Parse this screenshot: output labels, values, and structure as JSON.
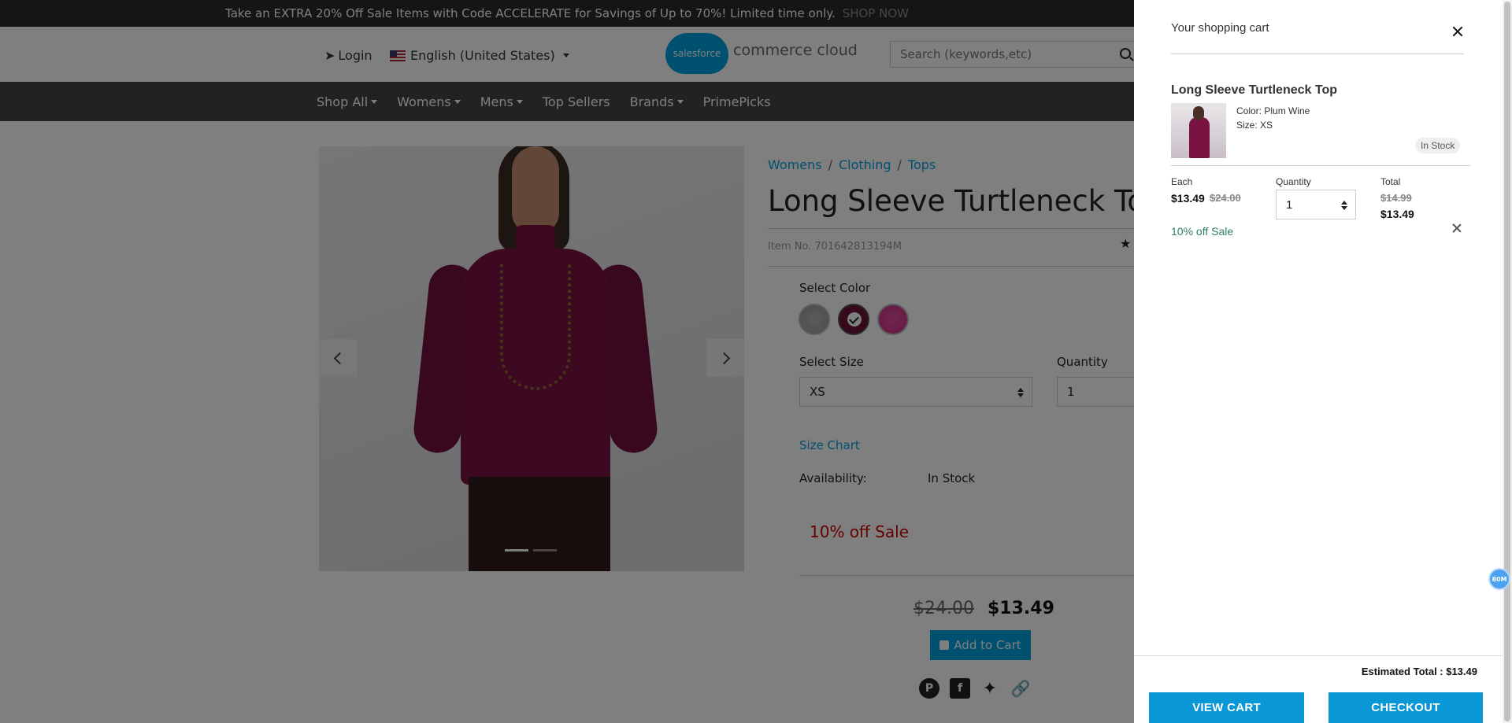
{
  "promo": {
    "text": "Take an EXTRA 20% Off Sale Items with Code ACCELERATE for Savings of Up to 70%! Limited time only.",
    "link": "SHOP NOW"
  },
  "header": {
    "login": "Login",
    "language": "English (United States)",
    "logo_badge": "salesforce",
    "logo_text": "commerce cloud",
    "search_placeholder": "Search (keywords,etc)"
  },
  "nav": [
    "Shop All",
    "Womens",
    "Mens",
    "Top Sellers",
    "Brands",
    "PrimePicks"
  ],
  "product": {
    "breadcrumb": [
      "Womens",
      "Clothing",
      "Tops"
    ],
    "title": "Long Sleeve Turtleneck Top",
    "item_no": "Item No. 701642813194M",
    "select_color_label": "Select Color",
    "colors": [
      "gray",
      "plum-wine",
      "pink"
    ],
    "selected_color": "plum-wine",
    "select_size_label": "Select Size",
    "size_value": "XS",
    "quantity_label": "Quantity",
    "quantity_value": "1",
    "size_chart": "Size Chart",
    "availability_label": "Availability:",
    "availability_value": "In Stock",
    "promo": "10% off Sale",
    "price_old": "$24.00",
    "price_new": "$13.49",
    "add_to_cart": "Add to Cart"
  },
  "cart": {
    "title": "Your shopping cart",
    "item": {
      "name": "Long Sleeve Turtleneck Top",
      "color": "Color: Plum Wine",
      "size": "Size: XS",
      "stock": "In Stock",
      "each_label": "Each",
      "each_price": "$13.49",
      "each_old": "$24.00",
      "quantity_label": "Quantity",
      "quantity": "1",
      "total_label": "Total",
      "total_old": "$14.99",
      "total_new": "$13.49",
      "promo": "10% off Sale"
    },
    "estimated_total": "Estimated Total : $13.49",
    "view_cart": "VIEW CART",
    "checkout": "CHECKOUT"
  },
  "extension_chip": "80M",
  "colors": {
    "accent": "#00a1e0",
    "cart_button": "#0a97d6",
    "nav_bg": "#444444",
    "promo_bar": "#2b2b2b",
    "sale_red": "#cc0000"
  }
}
